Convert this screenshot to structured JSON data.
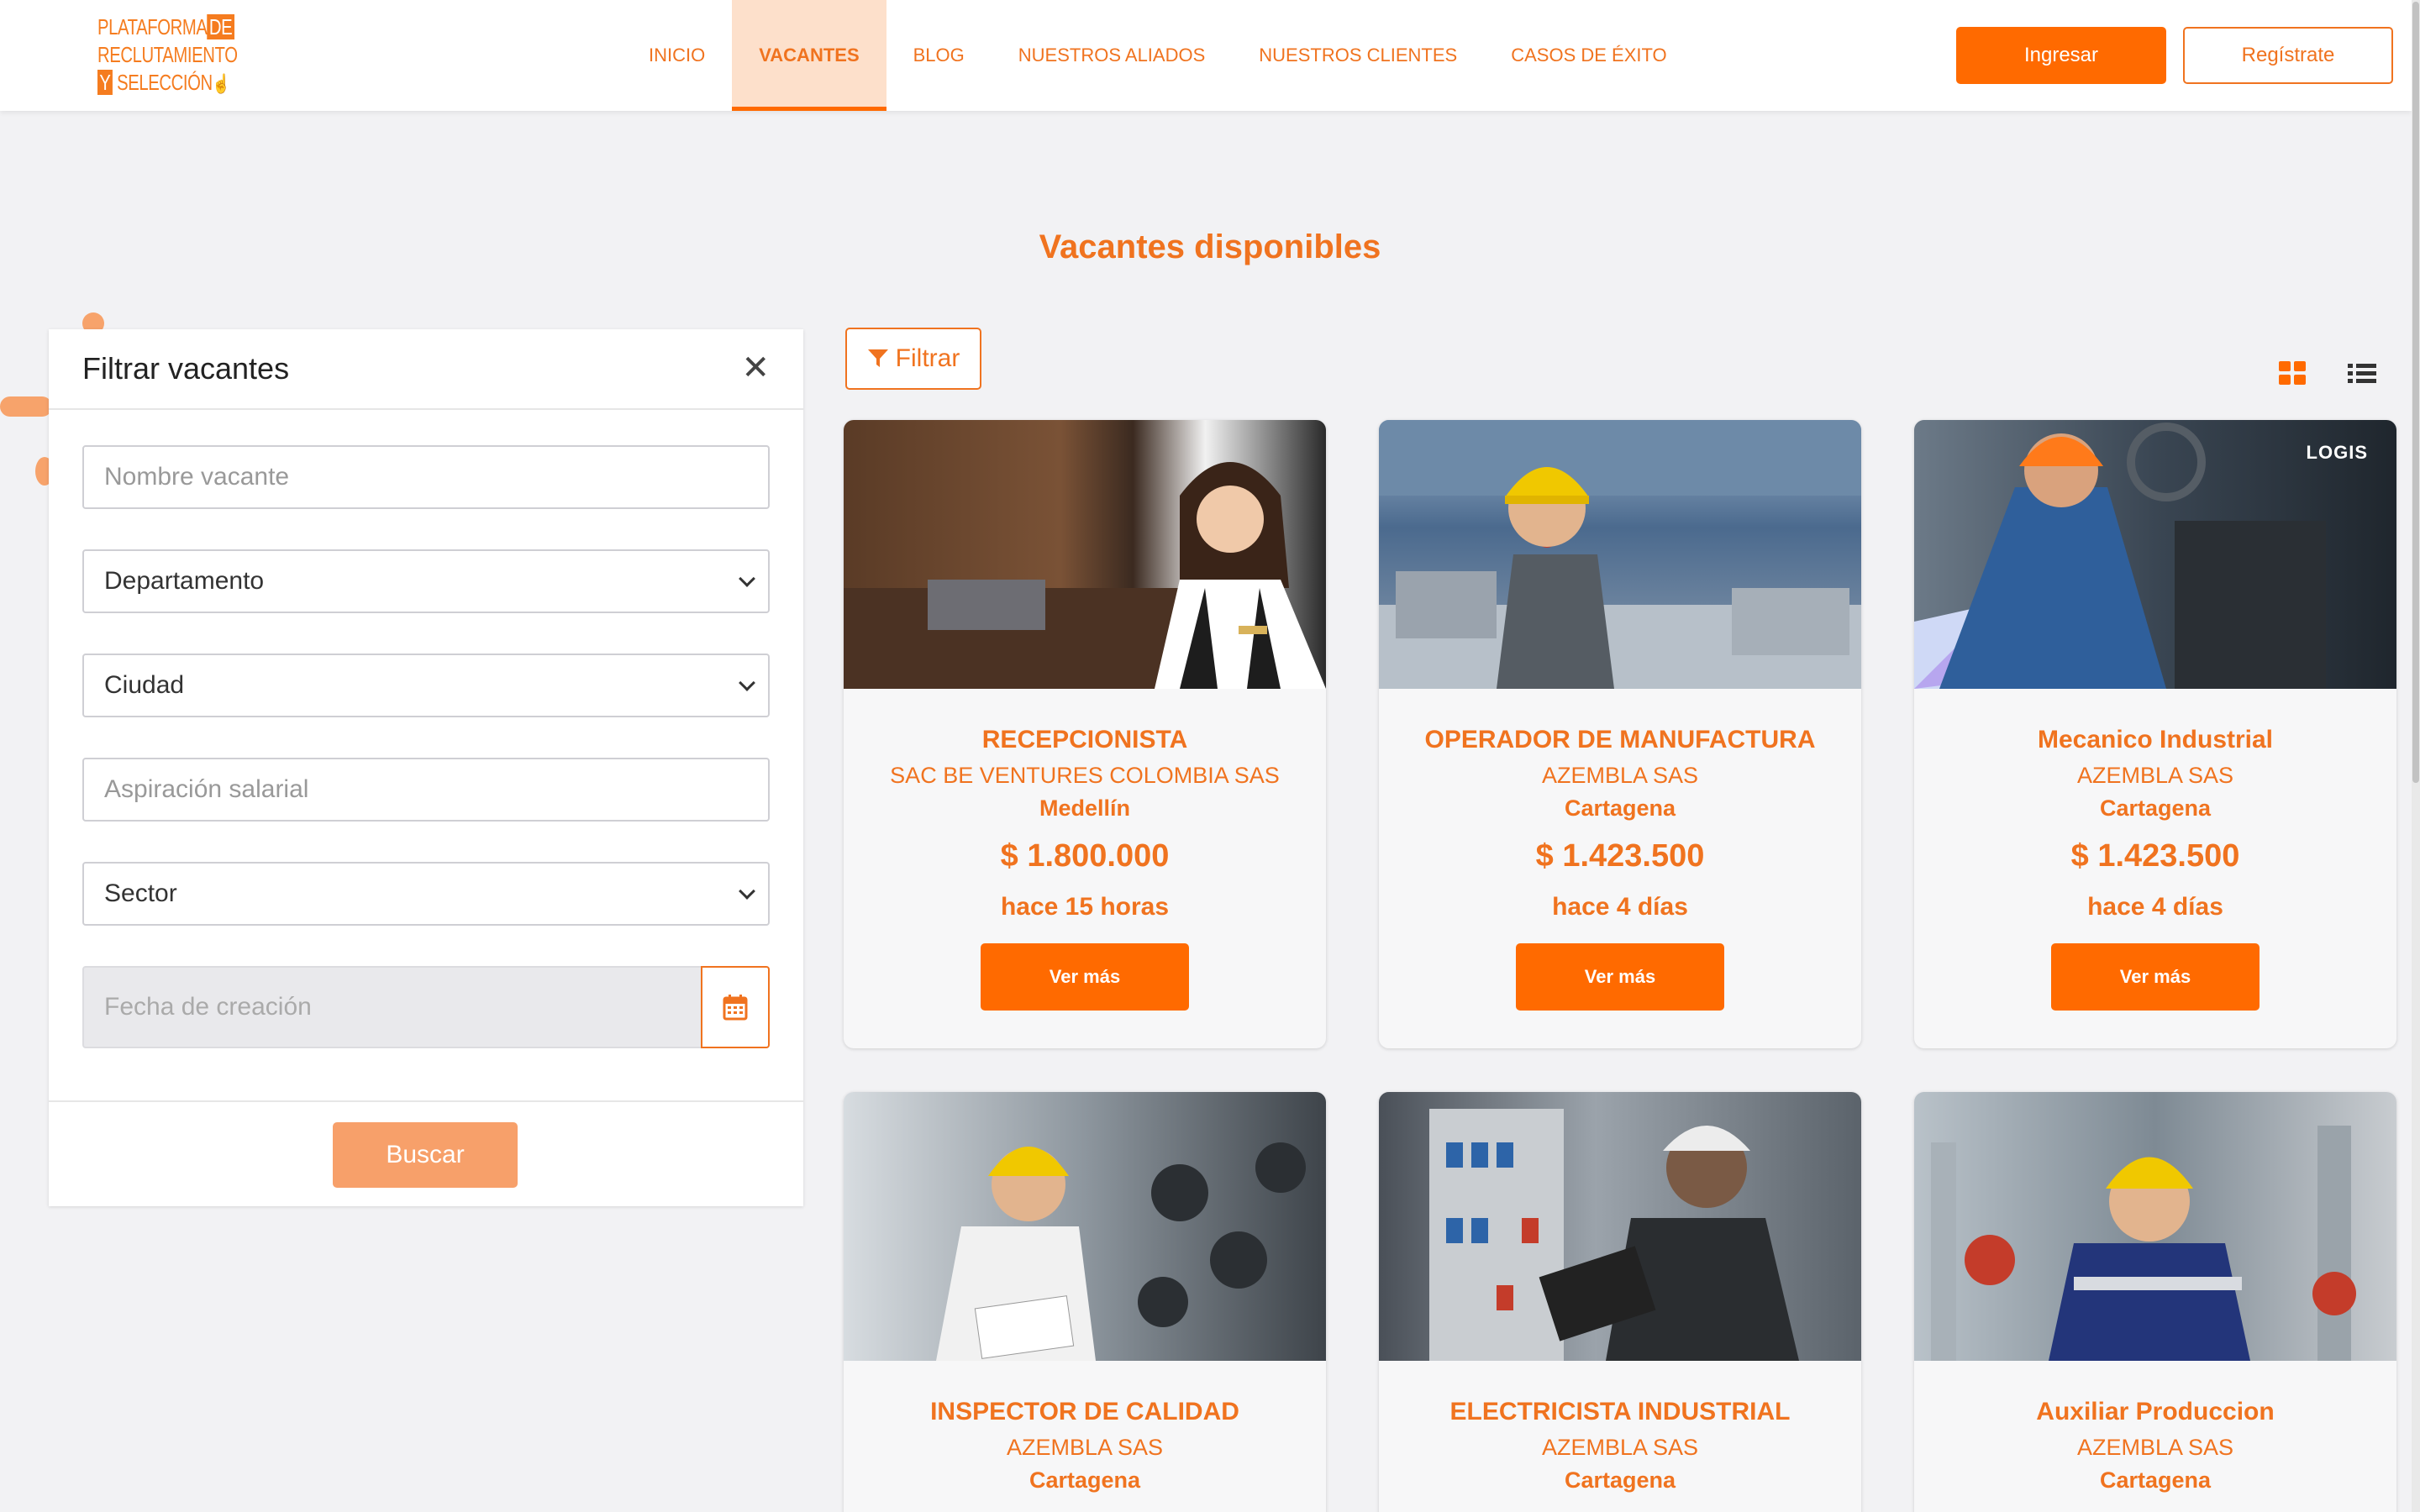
{
  "brand": {
    "logo_line1": "PLATAFORMA",
    "logo_line1_box": "DE",
    "logo_line2": "RECLUTAMIENTO",
    "logo_line3_box": "Y",
    "logo_line3": "SELECCIÓN",
    "accent_color": "#f0731f",
    "button_color": "#ff6a00"
  },
  "nav": {
    "items": [
      {
        "label": "INICIO"
      },
      {
        "label": "VACANTES"
      },
      {
        "label": "BLOG"
      },
      {
        "label": "NUESTROS ALIADOS"
      },
      {
        "label": "NUESTROS CLIENTES"
      },
      {
        "label": "CASOS DE ÉXITO"
      }
    ],
    "active": "VACANTES",
    "login_label": "Ingresar",
    "register_label": "Regístrate"
  },
  "page": {
    "title": "Vacantes disponibles"
  },
  "filter": {
    "title": "Filtrar vacantes",
    "close_icon": "close-icon",
    "name_placeholder": "Nombre vacante",
    "department_value": "Departamento",
    "city_value": "Ciudad",
    "salary_placeholder": "Aspiración salarial",
    "sector_value": "Sector",
    "date_placeholder": "Fecha de creación",
    "date_icon": "calendar-icon",
    "search_label": "Buscar"
  },
  "toolbar": {
    "filter_label": "Filtrar",
    "filter_icon": "funnel-icon",
    "grid_icon": "grid-view-icon",
    "list_icon": "list-view-icon"
  },
  "vacancies": [
    {
      "title": "RECEPCIONISTA",
      "company": "SAC BE VENTURES COLOMBIA SAS",
      "city": "Medellín",
      "salary": "$ 1.800.000",
      "posted": "hace 15 horas",
      "cta": "Ver más"
    },
    {
      "title": "OPERADOR DE MANUFACTURA",
      "company": "AZEMBLA SAS",
      "city": "Cartagena",
      "salary": "$ 1.423.500",
      "posted": "hace 4 días",
      "cta": "Ver más"
    },
    {
      "title": "Mecanico Industrial",
      "company": "AZEMBLA SAS",
      "city": "Cartagena",
      "salary": "$ 1.423.500",
      "posted": "hace 4 días",
      "cta": "Ver más",
      "image_badge": "LOGIS"
    },
    {
      "title": "INSPECTOR DE CALIDAD",
      "company": "AZEMBLA SAS",
      "city": "Cartagena"
    },
    {
      "title": "ELECTRICISTA INDUSTRIAL",
      "company": "AZEMBLA SAS",
      "city": "Cartagena"
    },
    {
      "title": "Auxiliar Produccion",
      "company": "AZEMBLA SAS",
      "city": "Cartagena"
    }
  ]
}
